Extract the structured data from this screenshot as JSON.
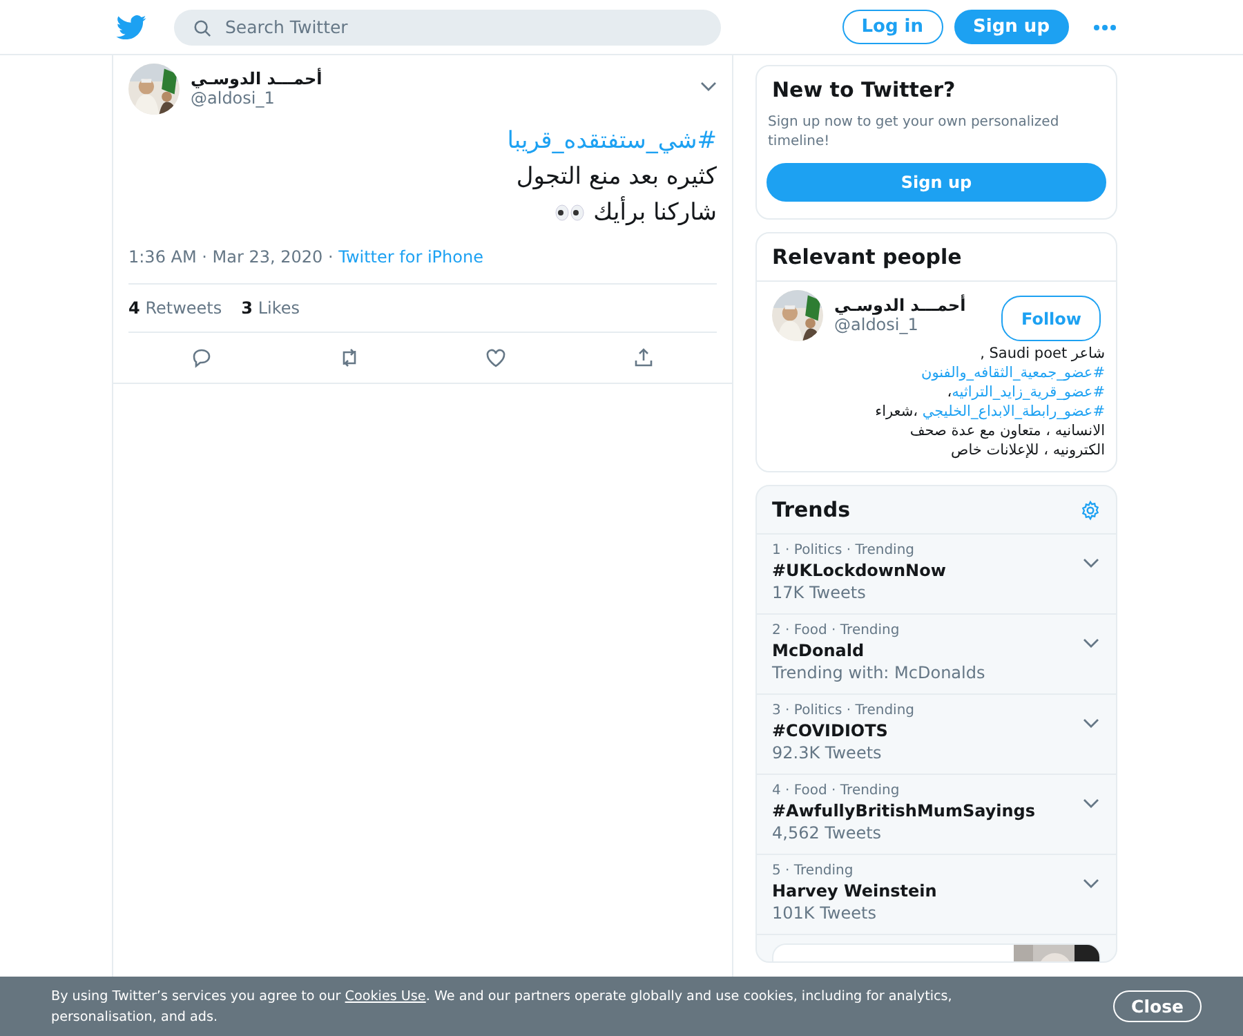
{
  "header": {
    "search": {
      "placeholder": "Search Twitter"
    },
    "login": "Log in",
    "signup": "Sign up"
  },
  "tweet": {
    "name": "أحمـــد الدوسـي",
    "handle": "@aldosi_1",
    "hashtag": "#شي_ستفتقده_قريبا",
    "lines": [
      "كثيره بعد منع التجول",
      "شاركنا برأيك"
    ],
    "time": "1:36 AM · Mar 23, 2020 · ",
    "source": "Twitter for iPhone",
    "stats": [
      {
        "count": "4",
        "label": "Retweets"
      },
      {
        "count": "3",
        "label": "Likes"
      }
    ]
  },
  "new_to_twitter": {
    "title": "New to Twitter?",
    "text": "Sign up now to get your own personalized timeline!",
    "button": "Sign up"
  },
  "relevant_people": {
    "title": "Relevant people",
    "name": "أحمـــد الدوسـي",
    "handle": "@aldosi_1",
    "follow": "Follow",
    "bio": [
      [
        {
          "kind": "text",
          "text": "شاعر Saudi poet ,"
        }
      ],
      [
        {
          "kind": "hashtag",
          "text": "#عضو_جمعية_الثقافه_والفنون"
        }
      ],
      [
        {
          "kind": "hashtag",
          "text": "#عضو_قرية_زايد_التراثيه"
        },
        {
          "kind": "text",
          "text": "،"
        }
      ],
      [
        {
          "kind": "hashtag",
          "text": "#عضو_رابطة_الابداع_الخليجي"
        },
        {
          "kind": "text",
          "text": " ،شعراء"
        }
      ],
      [
        {
          "kind": "text",
          "text": "الانسانيه ، متعاون مع عدة صحف"
        }
      ],
      [
        {
          "kind": "text",
          "text": "الكترونيه ، للإعلانات خاص"
        }
      ]
    ]
  },
  "trends": {
    "title": "Trends",
    "items": [
      {
        "context": "1 · Politics · Trending",
        "name": "#UKLockdownNow",
        "detail": "17K Tweets"
      },
      {
        "context": "2 · Food · Trending",
        "name": "McDonald",
        "detail": "Trending with: McDonalds"
      },
      {
        "context": "3 · Politics · Trending",
        "name": "#COVIDIOTS",
        "detail": "92.3K Tweets"
      },
      {
        "context": "4 · Food · Trending",
        "name": "#AwfullyBritishMumSayings",
        "detail": "4,562 Tweets"
      },
      {
        "context": "5 · Trending",
        "name": "Harvey Weinstein",
        "detail": "101K Tweets"
      }
    ]
  },
  "cookie_banner": {
    "before": "By using Twitter’s services you agree to our ",
    "link": "Cookies Use",
    "after": ". We and our partners operate globally and use cookies, including for analytics, personalisation, and ads.",
    "close": "Close"
  }
}
